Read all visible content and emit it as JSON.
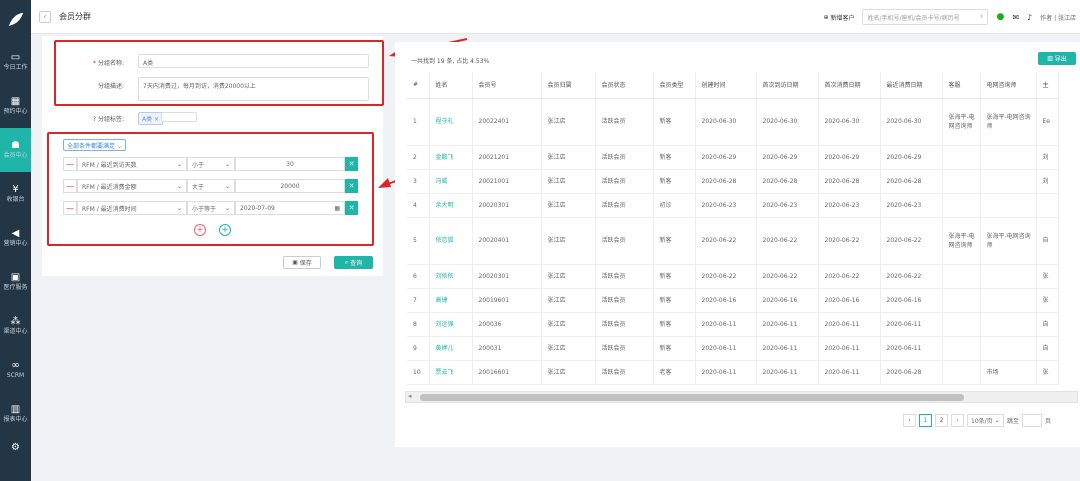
{
  "sidebar": {
    "items": [
      {
        "label": "今日工作",
        "icon": "laptop-icon"
      },
      {
        "label": "预约中心",
        "icon": "calendar-icon"
      },
      {
        "label": "会员中心",
        "icon": "users-icon",
        "active": true
      },
      {
        "label": "收银台",
        "icon": "yen-icon"
      },
      {
        "label": "营销中心",
        "icon": "megaphone-icon"
      },
      {
        "label": "医疗服务",
        "icon": "medkit-icon"
      },
      {
        "label": "渠道中心",
        "icon": "sitemap-icon"
      },
      {
        "label": "SCRM",
        "icon": "link-icon"
      },
      {
        "label": "报表中心",
        "icon": "chart-icon"
      }
    ]
  },
  "header": {
    "title": "会员分群",
    "new_customer": "新增客户",
    "search_placeholder": "姓名/手机号/座机/会员卡号/病历号",
    "user": "作者 | 张江店"
  },
  "form": {
    "name_label": "分组名称:",
    "name_value": "A类",
    "desc_label": "分组描述:",
    "desc_value": "7天内消费过，每月到访，消费20000以上",
    "tag_label": "分组标签:",
    "tag_value": "A类 ×",
    "cond_mode": "全部条件都要满足",
    "conditions": [
      {
        "field": "RFM / 最近到访天数",
        "op": "小于",
        "value": "30"
      },
      {
        "field": "RFM / 最近消费金额",
        "op": "大于",
        "value": "20000"
      },
      {
        "field": "RFM / 最近消费时间",
        "op": "小于等于",
        "value": "2020-07-09"
      }
    ],
    "save_label": "保存",
    "query_label": "查询"
  },
  "results": {
    "summary": "一共找到 19 条, 占比 4.53%",
    "export_label": "导出",
    "columns": [
      "#",
      "姓名",
      "会员号",
      "会员归属",
      "会员状态",
      "会员类型",
      "创建时间",
      "首次到访日期",
      "首次消费日期",
      "最近消费日期",
      "客服",
      "电网咨询师",
      "主"
    ],
    "rows": [
      [
        "1",
        "程守礼",
        "20022401",
        "张江店",
        "活跃会员",
        "新客",
        "2020-06-30",
        "2020-06-30",
        "2020-06-30",
        "2020-06-30",
        "张海平-电网咨询师",
        "张海平-电网咨询师",
        "Ee"
      ],
      [
        "2",
        "金鹏飞",
        "20021201",
        "张江店",
        "活跃会员",
        "新客",
        "2020-06-29",
        "2020-06-29",
        "2020-06-29",
        "2020-06-29",
        "",
        "",
        "刘"
      ],
      [
        "3",
        "冯威",
        "20021001",
        "张江店",
        "活跃会员",
        "新客",
        "2020-06-28",
        "2020-06-28",
        "2020-06-28",
        "2020-06-28",
        "",
        "",
        "刘"
      ],
      [
        "4",
        "余大明",
        "20020301",
        "张江店",
        "活跃会员",
        "初诊",
        "2020-06-23",
        "2020-06-23",
        "2020-06-23",
        "2020-06-23",
        "",
        "",
        ""
      ],
      [
        "5",
        "依恋狐",
        "20020401",
        "张江店",
        "活跃会员",
        "新客",
        "2020-06-22",
        "2020-06-22",
        "2020-06-22",
        "2020-06-22",
        "张海平-电网咨询师",
        "张海平-电网咨询师",
        "自"
      ],
      [
        "6",
        "刘依依",
        "20020301",
        "张江店",
        "活跃会员",
        "新客",
        "2020-06-22",
        "2020-06-22",
        "2020-06-22",
        "2020-06-22",
        "",
        "",
        "张"
      ],
      [
        "7",
        "高捷",
        "20019601",
        "张江店",
        "活跃会员",
        "新客",
        "2020-06-16",
        "2020-06-16",
        "2020-06-16",
        "2020-06-16",
        "",
        "",
        "张"
      ],
      [
        "8",
        "刘远强",
        "200036",
        "张江店",
        "活跃会员",
        "新客",
        "2020-06-11",
        "2020-06-11",
        "2020-06-11",
        "2020-06-11",
        "",
        "",
        "自"
      ],
      [
        "9",
        "黄婷儿",
        "200031",
        "张江店",
        "活跃会员",
        "新客",
        "2020-06-11",
        "2020-06-11",
        "2020-06-11",
        "2020-06-11",
        "",
        "",
        "自"
      ],
      [
        "10",
        "贾云飞",
        "20016601",
        "张江店",
        "活跃会员",
        "老客",
        "2020-06-11",
        "2020-06-11",
        "2020-06-11",
        "2020-06-28",
        "",
        "市场",
        "张"
      ]
    ],
    "pager": {
      "current": "1",
      "next": "2",
      "page_size": "10条/页",
      "goto_label": "跳至",
      "page_suffix": "页"
    }
  },
  "colors": {
    "accent": "#1fb5a8",
    "highlight": "#d9262b",
    "sidebar": "#223645"
  }
}
